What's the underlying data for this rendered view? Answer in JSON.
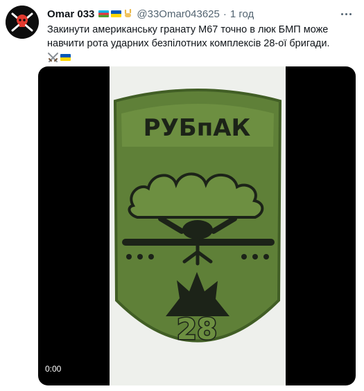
{
  "tweet": {
    "author_name": "Omar 033",
    "handle": "@33Omar043625",
    "separator": "·",
    "time": "1 год",
    "text": "Закинути американську гранату М67 точно в люк БМП може навчити рота ударних безпілотних комплексів 28-ої бригади.",
    "emoji_line_icons": [
      "crossed-swords-icon",
      "ukraine-flag-icon"
    ],
    "name_icons": [
      "azerbaijan-flag-icon",
      "ukraine-flag-icon",
      "rock-on-hand-icon"
    ]
  },
  "media": {
    "video_time": "0:00",
    "patch_title": "РУБпАК",
    "patch_number": "28"
  },
  "colors": {
    "patch_green": "#6d8f41",
    "patch_dark": "#1c2318",
    "frame_bg": "#eef0ec"
  }
}
